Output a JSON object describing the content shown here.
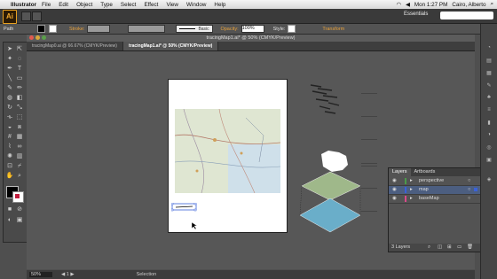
{
  "menubar": {
    "app_name": "Illustrator",
    "items": [
      "File",
      "Edit",
      "Object",
      "Type",
      "Select",
      "Effect",
      "View",
      "Window",
      "Help"
    ],
    "clock": "Mon 1:27 PM",
    "user": "Cairo, Alberto"
  },
  "appbar": {
    "logo": "Ai",
    "workspace": "Essentials"
  },
  "control": {
    "selection": "Path",
    "stroke_label": "Stroke:",
    "brush": "Basic",
    "opacity_label": "Opacity:",
    "opacity_value": "100%",
    "style_label": "Style:",
    "transform": "Transform"
  },
  "document": {
    "title": "tracingMap1.ai* @ 50% (CMYK/Preview)",
    "tabs": [
      "tracingMap0.ai @ 66.67% (CMYK/Preview)",
      "tracingMap1.ai* @ 50% (CMYK/Preview)"
    ]
  },
  "status": {
    "zoom": "50%",
    "tool": "Selection"
  },
  "layers_panel": {
    "tabs": [
      "Layers",
      "Artboards"
    ],
    "layers": [
      {
        "name": "perspective",
        "color": "#4a9a4a"
      },
      {
        "name": "map",
        "color": "#3a62d8"
      },
      {
        "name": "baseMap",
        "color": "#d84a8a"
      }
    ],
    "count": "3 Layers"
  },
  "colors": {
    "accent": "#e9a23b",
    "layer_selected": "#4c5e80",
    "map_green": "#9fb88a",
    "map_blue": "#6aaec9"
  }
}
